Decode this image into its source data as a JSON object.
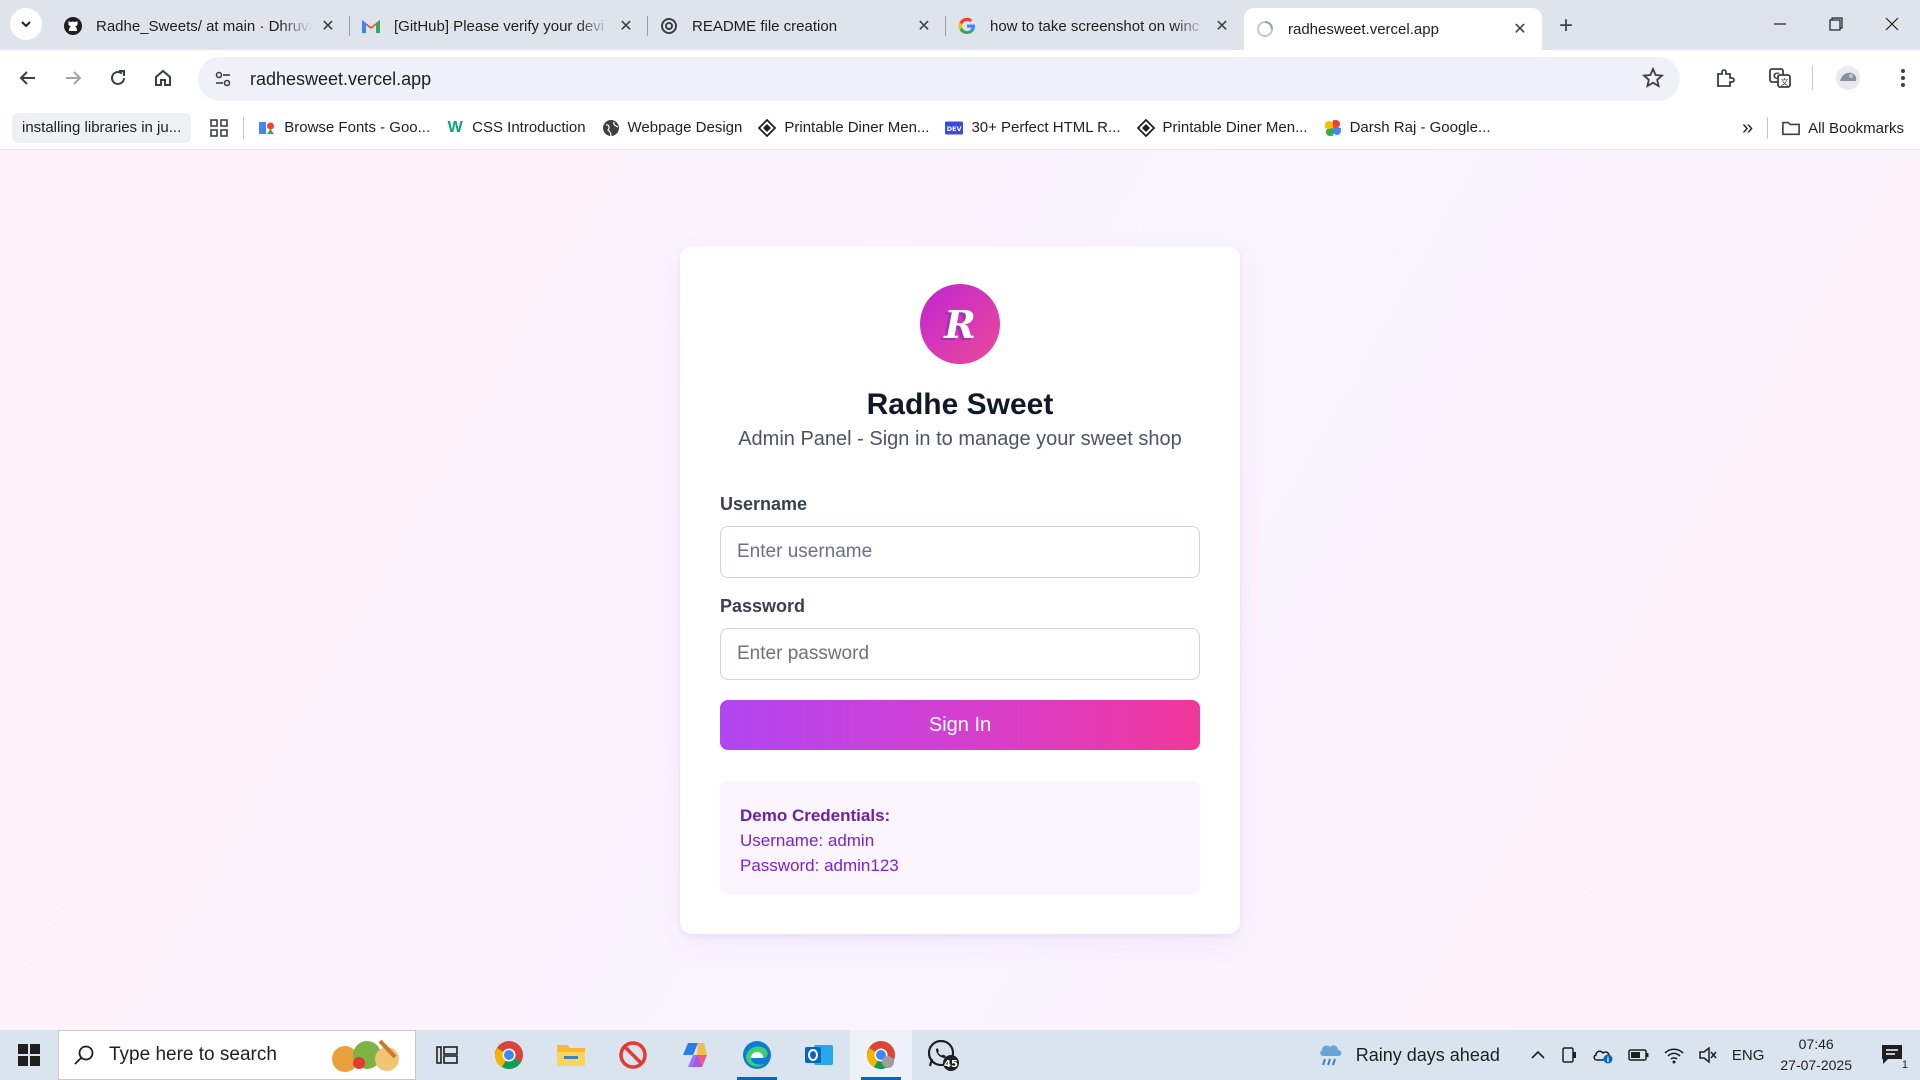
{
  "browser": {
    "tabs": [
      {
        "title": "Radhe_Sweets/ at main · Dhruvi",
        "icon": "github-icon",
        "active": false
      },
      {
        "title": "[GitHub] Please verify your devi",
        "icon": "gmail-icon",
        "active": false
      },
      {
        "title": "README file creation",
        "icon": "openai-icon",
        "active": false
      },
      {
        "title": "how to take screenshot on winc",
        "icon": "google-icon",
        "active": false
      },
      {
        "title": "radhesweet.vercel.app",
        "icon": "loading-globe-icon",
        "active": true
      }
    ],
    "url": "radhesweet.vercel.app"
  },
  "bookmarks": {
    "items": [
      {
        "label": "installing libraries in ju...",
        "icon": ""
      },
      {
        "label": "Browse Fonts - Goo...",
        "icon": "google-fonts-icon"
      },
      {
        "label": "CSS Introduction",
        "icon": "w3schools-icon"
      },
      {
        "label": "Webpage Design",
        "icon": "globe-icon"
      },
      {
        "label": "Printable Diner Men...",
        "icon": "diner-icon"
      },
      {
        "label": "30+ Perfect HTML R...",
        "icon": "dev-icon"
      },
      {
        "label": "Printable Diner Men...",
        "icon": "diner-icon"
      },
      {
        "label": "Darsh Raj - Google...",
        "icon": "google-photos-icon"
      }
    ],
    "all_bookmarks": "All Bookmarks"
  },
  "login": {
    "logo_letter": "R",
    "brand": "Radhe Sweet",
    "subtitle": "Admin Panel - Sign in to manage your sweet shop",
    "username_label": "Username",
    "username_placeholder": "Enter username",
    "password_label": "Password",
    "password_placeholder": "Enter password",
    "signin_label": "Sign In",
    "demo": {
      "title": "Demo Credentials:",
      "username": "Username: admin",
      "password": "Password: admin123"
    }
  },
  "taskbar": {
    "search_placeholder": "Type here to search",
    "weather": "Rainy days ahead",
    "language": "ENG",
    "time": "07:46",
    "date": "27-07-2025",
    "whatsapp_badge": "45",
    "notification_count": "1"
  },
  "colors": {
    "accent_purple": "#a855f7",
    "accent_pink": "#ec4899",
    "demo_text": "#7e22ce"
  }
}
